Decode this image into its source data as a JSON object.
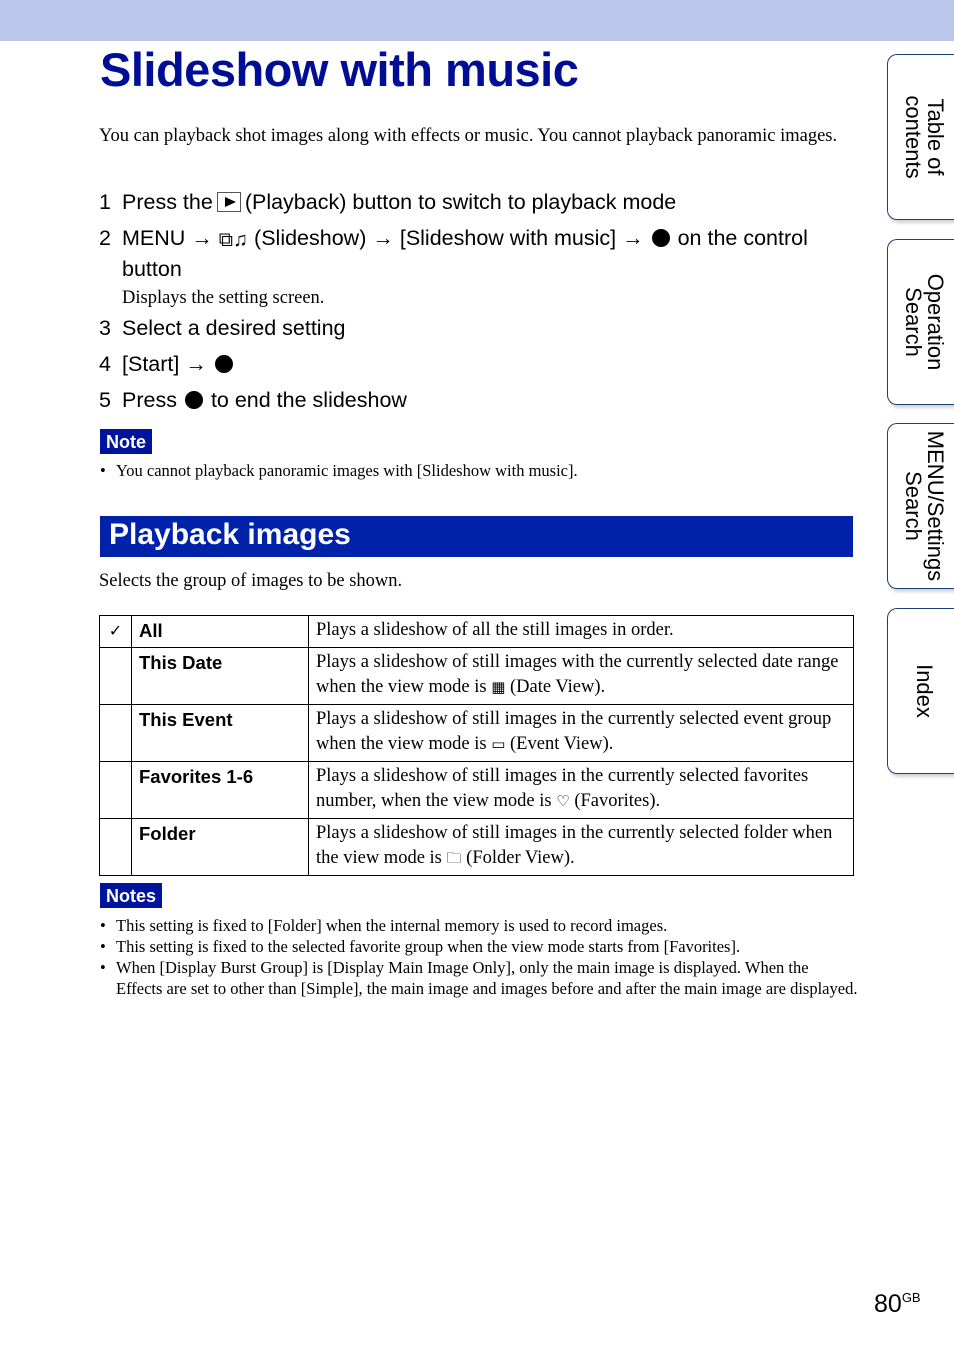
{
  "header": {
    "title": "Slideshow with music"
  },
  "intro": "You can playback shot images along with effects or music. You cannot playback panoramic images.",
  "steps": [
    {
      "num": "1",
      "before": "Press the",
      "icon": "playback-icon",
      "after": "(Playback) button to switch to playback mode"
    },
    {
      "num": "2",
      "p1": "MENU",
      "arrow": "→",
      "icon": "slideshow-icon",
      "p2": "(Slideshow)",
      "p3": "[Slideshow with music]",
      "p4": "on the control button",
      "sub": "Displays the setting screen."
    },
    {
      "num": "3",
      "text": "Select a desired setting"
    },
    {
      "num": "4",
      "text": "[Start]",
      "arrow": "→"
    },
    {
      "num": "5",
      "before": "Press",
      "after": "to end the slideshow"
    }
  ],
  "note": {
    "label": "Note",
    "items": [
      "You cannot playback panoramic images with [Slideshow with music]."
    ]
  },
  "section": {
    "title": "Playback images",
    "description": "Selects the group of images to be shown."
  },
  "table": {
    "rows": [
      {
        "checked": true,
        "check_icon": "✓",
        "name": "All",
        "desc": "Plays a slideshow of all the still images in order.",
        "icon_glyph": "",
        "desc_after": ""
      },
      {
        "checked": false,
        "name": "This Date",
        "desc": "Plays a slideshow of still images with the currently selected date range when the view mode is",
        "icon_glyph": "▦",
        "desc_after": "(Date View)."
      },
      {
        "checked": false,
        "name": "This Event",
        "desc": "Plays a slideshow of still images in the currently selected event group when the view mode is",
        "icon_glyph": "▭",
        "desc_after": "(Event View)."
      },
      {
        "checked": false,
        "name": "Favorites 1-6",
        "desc": "Plays a slideshow of still images in the currently selected favorites number, when the view mode is",
        "icon_glyph": "♡",
        "desc_after": "(Favorites)."
      },
      {
        "checked": false,
        "name": "Folder",
        "desc": "Plays a slideshow of still images in the currently selected folder when the view mode is",
        "icon_glyph": "🗀",
        "desc_after": "(Folder View)."
      }
    ]
  },
  "notes": {
    "label": "Notes",
    "items": [
      "This setting is fixed to [Folder] when the internal memory is used to record images.",
      "This setting is fixed to the selected favorite group when the view mode starts from [Favorites].",
      "When [Display Burst Group] is [Display Main Image Only], only the main image is displayed. When the Effects are set to other than [Simple], the main image and images before and after the main image are displayed."
    ]
  },
  "side_tabs": [
    {
      "line1": "Table of",
      "line2": "contents"
    },
    {
      "line1": "Operation",
      "line2": "Search"
    },
    {
      "line1": "MENU/Settings",
      "line2": "Search"
    },
    {
      "line1": "Index",
      "line2": ""
    }
  ],
  "page": {
    "number": "80",
    "suffix": "GB"
  },
  "colors": {
    "title": "#000e96",
    "section": "#0021aa",
    "badge": "#00139c",
    "topbar": "#b8c7ea"
  }
}
